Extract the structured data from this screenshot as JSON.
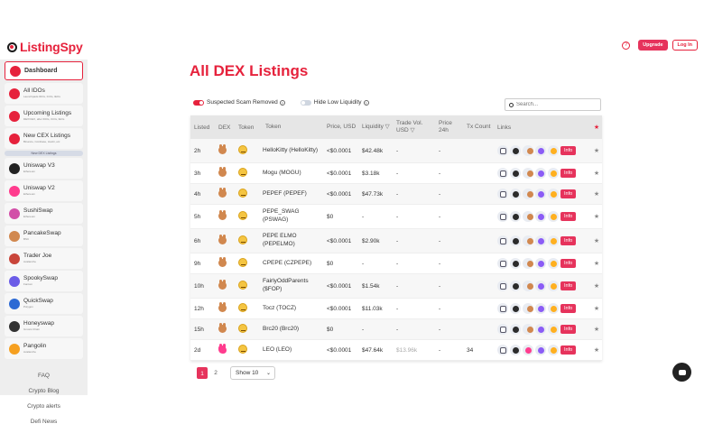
{
  "brand": {
    "name": "ListingSpy"
  },
  "header": {
    "upgrade_label": "Upgrade",
    "login_label": "Log In"
  },
  "sidebar": {
    "items": [
      {
        "label": "Dashboard",
        "sub": "",
        "icon": "grid-icon",
        "color": "#e6223c"
      },
      {
        "label": "All IDOs",
        "sub": "Launchpads IDOs, ICOs, IEOs",
        "icon": "rocket-icon",
        "color": "#e6223c"
      },
      {
        "label": "Upcoming Listings",
        "sub": "DEX/CEX, after IDOs, ICOs, IEOs",
        "icon": "calendar-icon",
        "color": "#e6223c"
      },
      {
        "label": "New CEX Listings",
        "sub": "Binance, Coinbase, Huobi, etc",
        "icon": "exchange-icon",
        "color": "#e6223c"
      }
    ],
    "new_dex_tag": "New DEX Listings",
    "dex_items": [
      {
        "label": "Uniswap V3",
        "sub": "Ethereum",
        "color": "#222"
      },
      {
        "label": "Uniswap V2",
        "sub": "Ethereum",
        "color": "#ff3c8e"
      },
      {
        "label": "SushiSwap",
        "sub": "Ethereum",
        "color": "#d24fa8"
      },
      {
        "label": "PancakeSwap",
        "sub": "BSC",
        "color": "#d1884f"
      },
      {
        "label": "Trader Joe",
        "sub": "Avalanche",
        "color": "#c9453a"
      },
      {
        "label": "SpookySwap",
        "sub": "Fantom",
        "color": "#6b5ce7"
      },
      {
        "label": "QuickSwap",
        "sub": "Polygon",
        "color": "#2d6ad4"
      },
      {
        "label": "Honeyswap",
        "sub": "Gnosis Chain",
        "color": "#333"
      },
      {
        "label": "Pangolin",
        "sub": "Avalanche",
        "color": "#f6a020"
      }
    ],
    "footer_links": [
      "FAQ",
      "Crypto Blog",
      "Crypto alerts",
      "Defi News"
    ]
  },
  "main": {
    "title": "All DEX Listings",
    "filter_scam": "Suspected Scam Removed",
    "filter_liquidity": "Hide Low Liquidity",
    "search_placeholder": "Search..."
  },
  "table": {
    "headers": {
      "listed": "Listed",
      "dex": "DEX",
      "token": "Token",
      "name": "Token",
      "price": "Price, USD",
      "liquidity": "Liquidity ▽",
      "trade_vol": "Trade Vol. USD ▽",
      "price24": "Price 24h",
      "tx": "Tx Count",
      "links": "Links",
      "fav": "★"
    },
    "rows": [
      {
        "listed": "2h",
        "dex": "pancakeswap",
        "name": "HelloKitty (HelloKitty)",
        "price": "<$0.0001",
        "liquidity": "$42.48k",
        "trade_vol": "-",
        "price24": "-",
        "tx": "",
        "vol_muted": false
      },
      {
        "listed": "3h",
        "dex": "pancakeswap",
        "name": "Mogu (MOGU)",
        "price": "<$0.0001",
        "liquidity": "$3.18k",
        "trade_vol": "-",
        "price24": "-",
        "tx": "",
        "vol_muted": false
      },
      {
        "listed": "4h",
        "dex": "pancakeswap",
        "name": "PEPEF (PEPEF)",
        "price": "<$0.0001",
        "liquidity": "$47.73k",
        "trade_vol": "-",
        "price24": "-",
        "tx": "",
        "vol_muted": false
      },
      {
        "listed": "5h",
        "dex": "pancakeswap",
        "name": "PEPE_SWAG (PSWAG)",
        "price": "$0",
        "liquidity": "-",
        "trade_vol": "-",
        "price24": "-",
        "tx": "",
        "vol_muted": false
      },
      {
        "listed": "6h",
        "dex": "pancakeswap",
        "name": "PEPE ELMO (PEPELMO)",
        "price": "<$0.0001",
        "liquidity": "$2.90k",
        "trade_vol": "-",
        "price24": "-",
        "tx": "",
        "vol_muted": false
      },
      {
        "listed": "9h",
        "dex": "pancakeswap",
        "name": "CPEPE (CZPEPE)",
        "price": "$0",
        "liquidity": "-",
        "trade_vol": "-",
        "price24": "-",
        "tx": "",
        "vol_muted": false
      },
      {
        "listed": "10h",
        "dex": "pancakeswap",
        "name": "FairlyOddParents ($FOP)",
        "price": "<$0.0001",
        "liquidity": "$1.54k",
        "trade_vol": "-",
        "price24": "-",
        "tx": "",
        "vol_muted": false
      },
      {
        "listed": "12h",
        "dex": "pancakeswap",
        "name": "Tocz (TOCZ)",
        "price": "<$0.0001",
        "liquidity": "$11.03k",
        "trade_vol": "-",
        "price24": "-",
        "tx": "",
        "vol_muted": false
      },
      {
        "listed": "15h",
        "dex": "pancakeswap",
        "name": "Brc20 (Brc20)",
        "price": "$0",
        "liquidity": "-",
        "trade_vol": "-",
        "price24": "-",
        "tx": "",
        "vol_muted": false
      },
      {
        "listed": "2d",
        "dex": "uniswap",
        "name": "LEO (LEO)",
        "price": "<$0.0001",
        "liquidity": "$47.64k",
        "trade_vol": "$13.96k",
        "price24": "-",
        "tx": "34",
        "vol_muted": true
      }
    ],
    "info_label": "Info",
    "fav_label": "★"
  },
  "pagination": {
    "pages": [
      "1",
      "2"
    ],
    "show_label": "Show 10",
    "show_caret": "⌄"
  }
}
